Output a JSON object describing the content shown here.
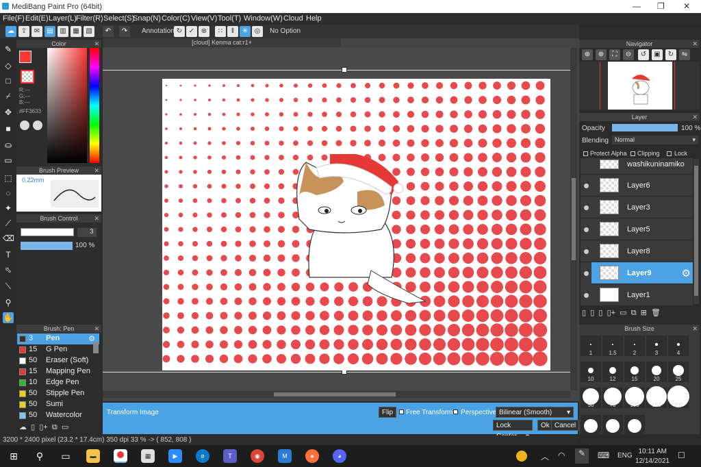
{
  "app": {
    "title": "MediBang Paint Pro (64bit)"
  },
  "menu": [
    "File(F)",
    "Edit(E)",
    "Layer(L)",
    "Filter(R)",
    "Select(S)",
    "Snap(N)",
    "Color(C)",
    "View(V)",
    "Tool(T)",
    "Window(W)",
    "Cloud",
    "Help"
  ],
  "toolbar": {
    "annotation_label": "Annotation",
    "no_option_label": "No Option"
  },
  "color_panel": {
    "title": "Color",
    "r": "R:---",
    "g": "G:---",
    "b": "B:---",
    "hex": "#FF3633",
    "fg_color": "#ff3633"
  },
  "brush_preview": {
    "title": "Brush Preview",
    "size": "0.22mm"
  },
  "brush_control": {
    "title": "Brush Control",
    "size_value": "3",
    "opacity_value": "100 %"
  },
  "brush_list": {
    "title": "Brush: Pen",
    "items": [
      {
        "num": "3",
        "name": "Pen",
        "color": "#333333"
      },
      {
        "num": "15",
        "name": "G Pen",
        "color": "#e53935"
      },
      {
        "num": "50",
        "name": "Eraser (Soft)",
        "color": "#ffffff"
      },
      {
        "num": "15",
        "name": "Mapping Pen",
        "color": "#e53935"
      },
      {
        "num": "10",
        "name": "Edge Pen",
        "color": "#2eb82e"
      },
      {
        "num": "50",
        "name": "Stipple Pen",
        "color": "#e6d21f"
      },
      {
        "num": "50",
        "name": "Sumi",
        "color": "#e6d21f"
      },
      {
        "num": "50",
        "name": "Watercolor",
        "color": "#7ec8f0"
      }
    ]
  },
  "document": {
    "tab_title": "[cloud] Kenma cat:r1+"
  },
  "navigator": {
    "title": "Navigator"
  },
  "layer_panel": {
    "title": "Layer",
    "opacity_label": "Opacity",
    "opacity_value": "100 %",
    "blending_label": "Blending",
    "blending_value": "Normal",
    "protect_alpha": "Protect Alpha",
    "clipping": "Clipping",
    "lock": "Lock",
    "top_layer": "washikuninamiko",
    "layers": [
      {
        "name": "Layer6"
      },
      {
        "name": "Layer3"
      },
      {
        "name": "Layer5"
      },
      {
        "name": "Layer8"
      },
      {
        "name": "Layer9",
        "selected": true
      },
      {
        "name": "Layer1"
      }
    ]
  },
  "brush_size": {
    "title": "Brush Size",
    "sizes": [
      "1",
      "1.5",
      "2",
      "3",
      "4",
      "10",
      "12",
      "15",
      "20",
      "25",
      "50",
      "70",
      "100",
      "150",
      "200"
    ]
  },
  "transform": {
    "label": "Transform Image",
    "flip": "Flip",
    "free_transform": "Free Transform",
    "perspective": "Perspective",
    "interpolation": "Bilinear (Smooth)",
    "lock_center": "Lock Center",
    "ok": "Ok",
    "cancel": "Cancel"
  },
  "status": {
    "text": "3200 * 2400 pixel   (23.2 * 17.4cm)   350 dpi   33 %   -> ( 852, 808 )"
  },
  "taskbar": {
    "lang": "ENG",
    "time": "10:11 AM",
    "date": "12/14/2021"
  }
}
